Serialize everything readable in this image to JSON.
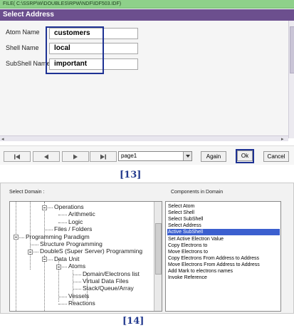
{
  "panel13": {
    "file_bar": "FILE( C:\\SSRP\\W\\DOUBLES\\RPW\\NDF\\IDF503.IDF)",
    "dialog_title": "Select Address",
    "fields": [
      {
        "label": "Atom Name",
        "value": "customers"
      },
      {
        "label": "Shell Name",
        "value": "local"
      },
      {
        "label": "SubShell Name",
        "value": "important"
      }
    ],
    "page_select": "page1",
    "again_label": "Again",
    "ok_label": "Ok",
    "cancel_label": "Cancel",
    "caption": "[13]"
  },
  "panel14": {
    "select_domain_label": "Select Domain :",
    "components_label": "Components in Domain",
    "tree": [
      {
        "text": "Operations",
        "level": 3,
        "toggle": true
      },
      {
        "text": "Arithmetic",
        "level": 4
      },
      {
        "text": "Logic",
        "level": 4
      },
      {
        "text": "Files / Folders",
        "level": 3
      },
      {
        "text": "Programming Paradigm",
        "level": 1,
        "toggle": true
      },
      {
        "text": "Structure Programming",
        "level": 2
      },
      {
        "text": "DoubleS (Super Server) Programming",
        "level": 2,
        "toggle": true
      },
      {
        "text": "Data Unit",
        "level": 3,
        "toggle": true
      },
      {
        "text": "Atoms",
        "level": 4,
        "toggle": true
      },
      {
        "text": "Domain/Electrons list",
        "level": 5
      },
      {
        "text": "Virtual Data Files",
        "level": 5
      },
      {
        "text": "Stack/Queue/Array",
        "level": 5
      },
      {
        "text": "Vessels",
        "level": 4
      },
      {
        "text": "Reactions",
        "level": 4
      }
    ],
    "components": [
      "Select Atom",
      "Select Shell",
      "Select SubShell",
      "Select Address",
      "Active SubShell",
      "Set Active Electron Value",
      "Copy Electrons to",
      "Move Electrons to",
      "Copy Electrons From Address to Address",
      "Move Electrons From Address to Address",
      "Add Mark to electrons names",
      "Invoke Reference"
    ],
    "selected_component": "Active SubShell",
    "caption": "[14]"
  },
  "colors": {
    "title_bar": "#6c4f8e",
    "file_bar": "#8ed08a",
    "highlight_box": "#1e3294",
    "selection": "#3b5fcf"
  }
}
